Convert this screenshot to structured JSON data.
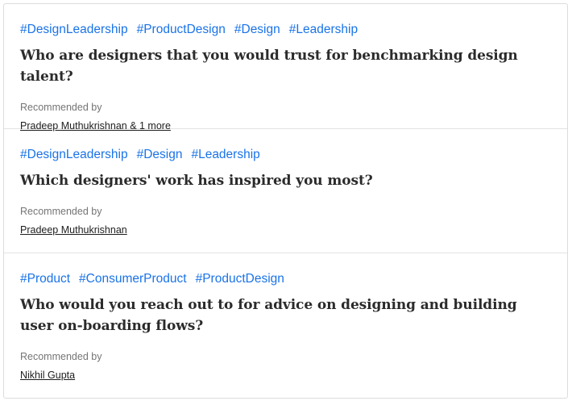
{
  "cards": [
    {
      "tags": [
        "#DesignLeadership",
        "#ProductDesign",
        "#Design",
        "#Leadership"
      ],
      "question": "Who are designers that you would trust for benchmarking design talent?",
      "recommended_label": "Recommended by",
      "recommenders": "Pradeep Muthukrishnan & 1 more"
    },
    {
      "tags": [
        "#DesignLeadership",
        "#Design",
        "#Leadership"
      ],
      "question": "Which designers' work has inspired you most?",
      "recommended_label": "Recommended by",
      "recommenders": "Pradeep Muthukrishnan"
    },
    {
      "tags": [
        "#Product",
        "#ConsumerProduct",
        "#ProductDesign"
      ],
      "question": "Who would you reach out to for advice on designing and building user on-boarding flows?",
      "recommended_label": "Recommended by",
      "recommenders": "Nikhil Gupta"
    }
  ],
  "colors": {
    "tag": "#1a73e8",
    "question": "#2b2b2b",
    "muted": "#757575"
  }
}
